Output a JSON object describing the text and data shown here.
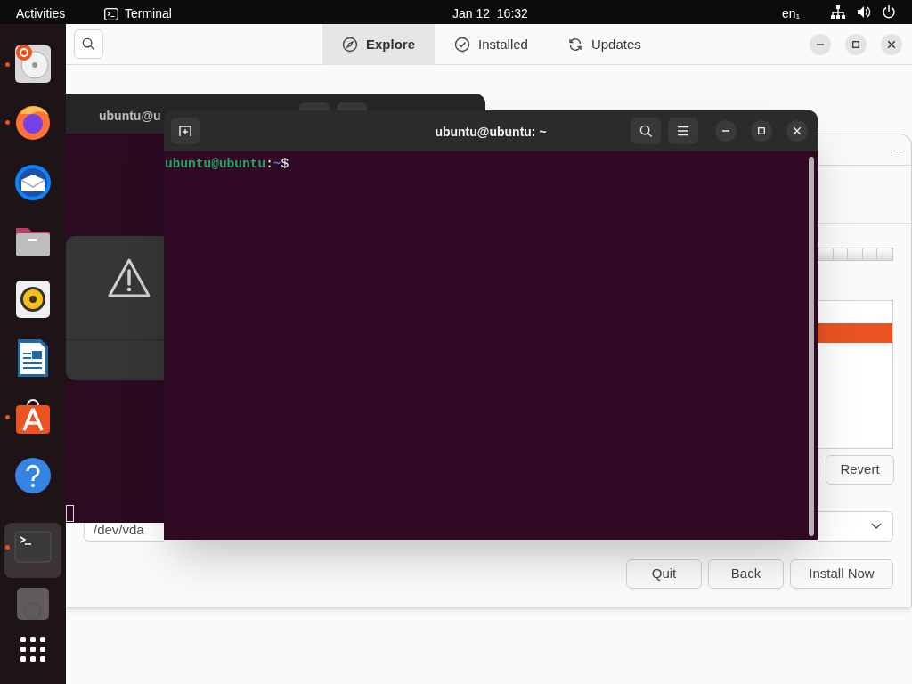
{
  "top_bar": {
    "activities": "Activities",
    "app_name": "Terminal",
    "clock": "Jan 12  16:32",
    "keyboard": "en₁"
  },
  "dock": [
    {
      "kind": "installer",
      "running": true,
      "active": false
    },
    {
      "kind": "firefox",
      "running": true,
      "active": false
    },
    {
      "kind": "mail",
      "running": false,
      "active": false
    },
    {
      "kind": "files",
      "running": false,
      "active": false
    },
    {
      "kind": "music",
      "running": false,
      "active": false
    },
    {
      "kind": "writer",
      "running": false,
      "active": false
    },
    {
      "kind": "store",
      "running": true,
      "active": false
    },
    {
      "kind": "help",
      "running": false,
      "active": false
    },
    {
      "kind": "terminal",
      "running": true,
      "active": true
    },
    {
      "kind": "disk",
      "running": false,
      "active": false
    },
    {
      "kind": "grid",
      "running": false,
      "active": false
    }
  ],
  "software_window": {
    "tabs": [
      {
        "label": "Explore",
        "kind": "explore",
        "selected": true
      },
      {
        "label": "Installed",
        "kind": "installed",
        "selected": false
      },
      {
        "label": "Updates",
        "kind": "updates",
        "selected": false
      }
    ]
  },
  "installer_window": {
    "partition_rows": [
      {
        "selected": true
      }
    ],
    "revert": "Revert",
    "device": "/dev/vda",
    "buttons": [
      "Quit",
      "Back",
      "Install Now"
    ]
  },
  "back_terminal": {
    "title": "ubuntu@u"
  },
  "terminal": {
    "title": "ubuntu@ubuntu: ~",
    "user_host": "ubuntu@ubuntu",
    "colon": ":",
    "path": "~",
    "prompt": "$"
  }
}
